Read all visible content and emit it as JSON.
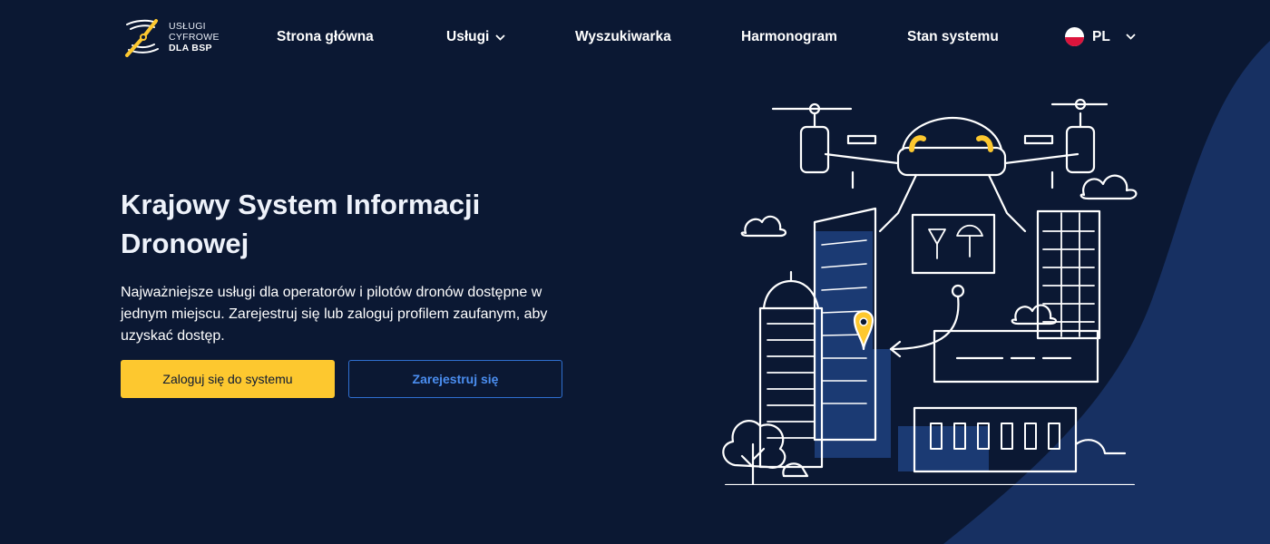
{
  "brand": {
    "logo_line1": "USŁUGI",
    "logo_line2": "CYFROWE",
    "logo_line3": "DLA BSP"
  },
  "nav": {
    "items": [
      {
        "label": "Strona główna"
      },
      {
        "label": "Usługi",
        "has_dropdown": true
      },
      {
        "label": "Wyszukiwarka"
      },
      {
        "label": "Harmonogram"
      },
      {
        "label": "Stan systemu"
      }
    ],
    "language": {
      "code": "PL",
      "flag_icon": "poland-flag-icon"
    }
  },
  "hero": {
    "title": "Krajowy System Informacji Dronowej",
    "description": "Najważniejsze usługi dla operatorów i pilotów dronów dostępne w jednym miejscu. Zarejestruj się lub zaloguj profilem zaufanym, aby uzyskać dostęp.",
    "login_button": "Zaloguj się do systemu",
    "register_button": "Zarejestruj się"
  },
  "colors": {
    "background": "#0b1833",
    "accent_shape": "#173062",
    "primary_button": "#fdc82f",
    "link_blue": "#4b8ef0",
    "illustration_yellow": "#fdc82f"
  },
  "illustration": {
    "icon": "drone-city-illustration"
  }
}
